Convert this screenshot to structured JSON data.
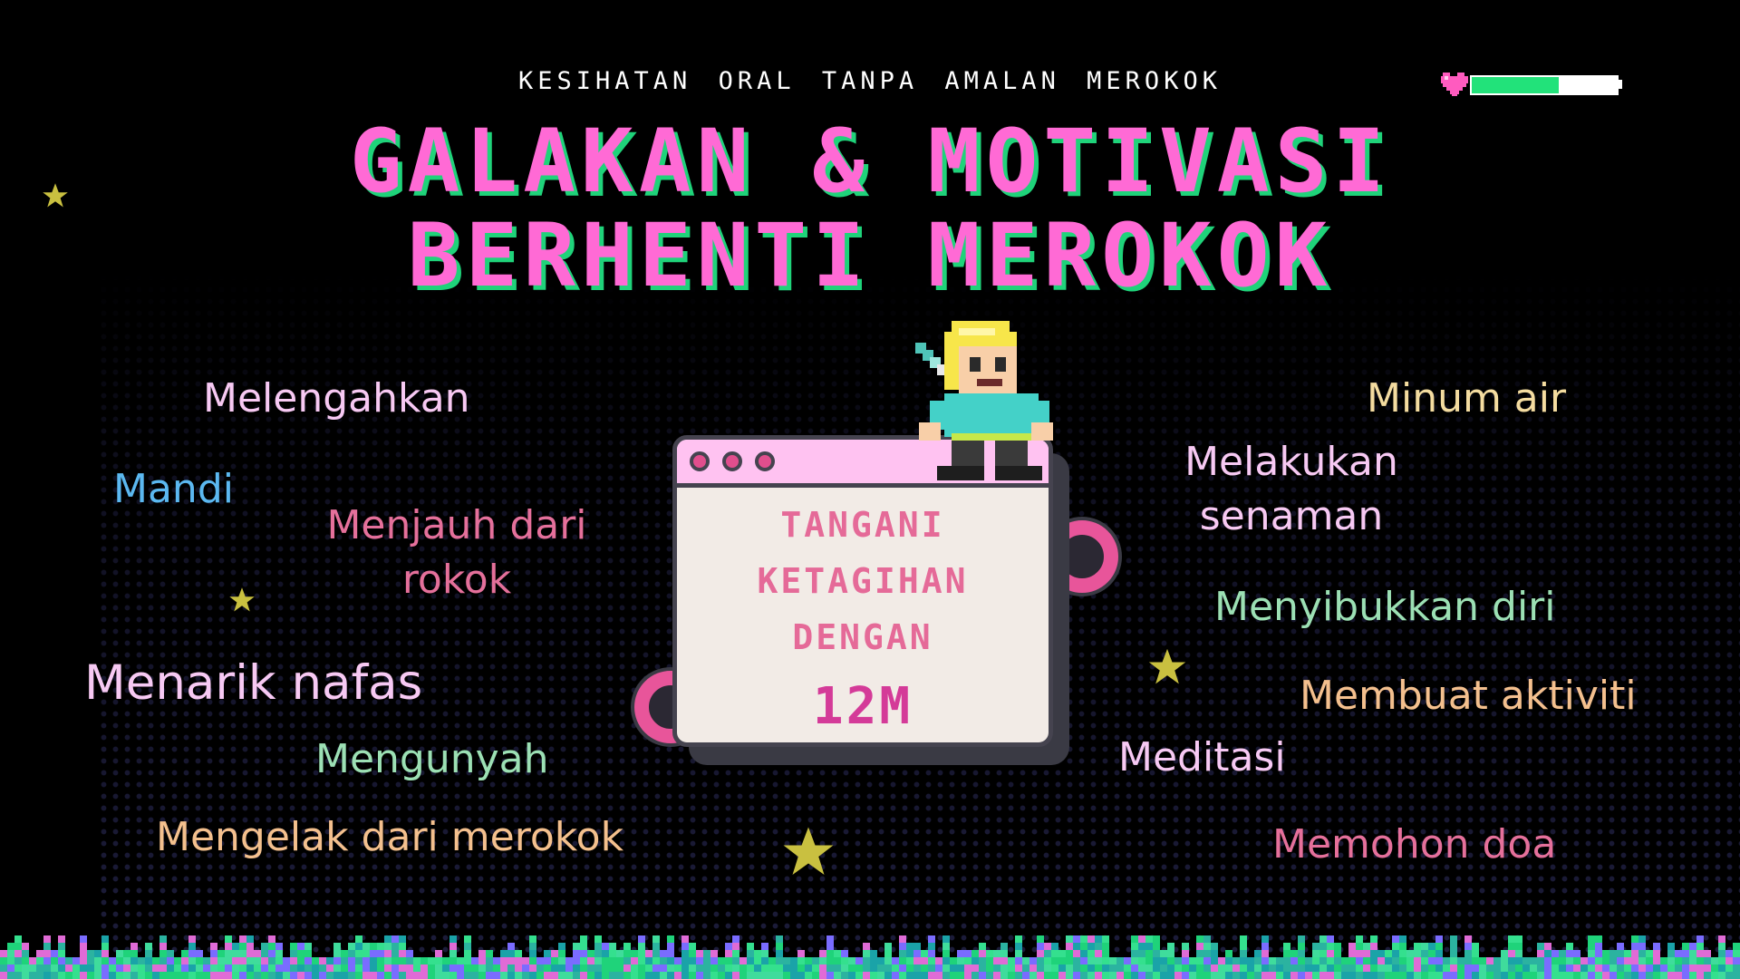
{
  "subtitle": "KESIHATAN ORAL TANPA AMALAN MEROKOK",
  "title": {
    "line1": "GALAKAN & MOTIVASI",
    "line2": "BERHENTI MEROKOK"
  },
  "battery": {
    "level": 0.6,
    "fill_color": "#22e27a",
    "heart_color": "#ff5bbf"
  },
  "window": {
    "lines": [
      "TANGANI",
      "KETAGIHAN",
      "DENGAN"
    ],
    "value": "12M"
  },
  "left_words": [
    {
      "text": "Melengahkan",
      "color": "#f7c9f3"
    },
    {
      "text": "Mandi",
      "color": "#5bb8f0"
    },
    {
      "text": "Menjauh dari",
      "color": "#e5709b"
    },
    {
      "text": "rokok",
      "color": "#e5709b"
    },
    {
      "text": "Menarik nafas",
      "color": "#f7c9f3"
    },
    {
      "text": "Mengunyah",
      "color": "#9ce0b4"
    },
    {
      "text": "Mengelak dari merokok",
      "color": "#f4c08e"
    }
  ],
  "right_words": [
    {
      "text": "Minum air",
      "color": "#f4dca0"
    },
    {
      "text": "Melakukan",
      "color": "#f7c9f3"
    },
    {
      "text": "senaman",
      "color": "#f7c9f3"
    },
    {
      "text": "Menyibukkan diri",
      "color": "#9ce0b4"
    },
    {
      "text": "Membuat aktiviti",
      "color": "#f4c08e"
    },
    {
      "text": "Meditasi",
      "color": "#f7c9f3"
    },
    {
      "text": "Memohon doa",
      "color": "#e5709b"
    }
  ],
  "colors": {
    "title": "#ff6ad5",
    "title_shadow": "#1fd37a",
    "star": "#c9c040",
    "window_accent": "#e14e8d"
  },
  "icons": [
    "heart-icon",
    "star-icon",
    "pixel-character-icon",
    "window-dot-icon"
  ]
}
